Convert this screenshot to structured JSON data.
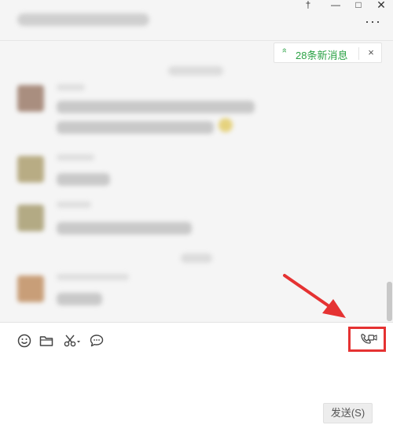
{
  "window": {
    "pin_icon": "pin-icon",
    "minimize_icon": "minimize-icon",
    "maximize_icon": "maximize-icon",
    "close_icon": "close-icon",
    "pin_glyph": "†",
    "min_glyph": "—",
    "max_glyph": "□",
    "close_glyph": "✕"
  },
  "header": {
    "more_glyph": "···"
  },
  "chat": {
    "new_messages": {
      "chevron": "»",
      "label": "28条新消息",
      "close_glyph": "×",
      "color": "#2ba245"
    }
  },
  "toolbar": {
    "emoji_icon": "emoji-icon",
    "file_icon": "folder-icon",
    "screenshot_icon": "scissors-icon",
    "chat_history_icon": "chat-bubble-icon",
    "video_call_icon": "video-call-icon"
  },
  "input": {
    "send_label": "发送(S)"
  },
  "annotation": {
    "highlight_color": "#e53232"
  }
}
